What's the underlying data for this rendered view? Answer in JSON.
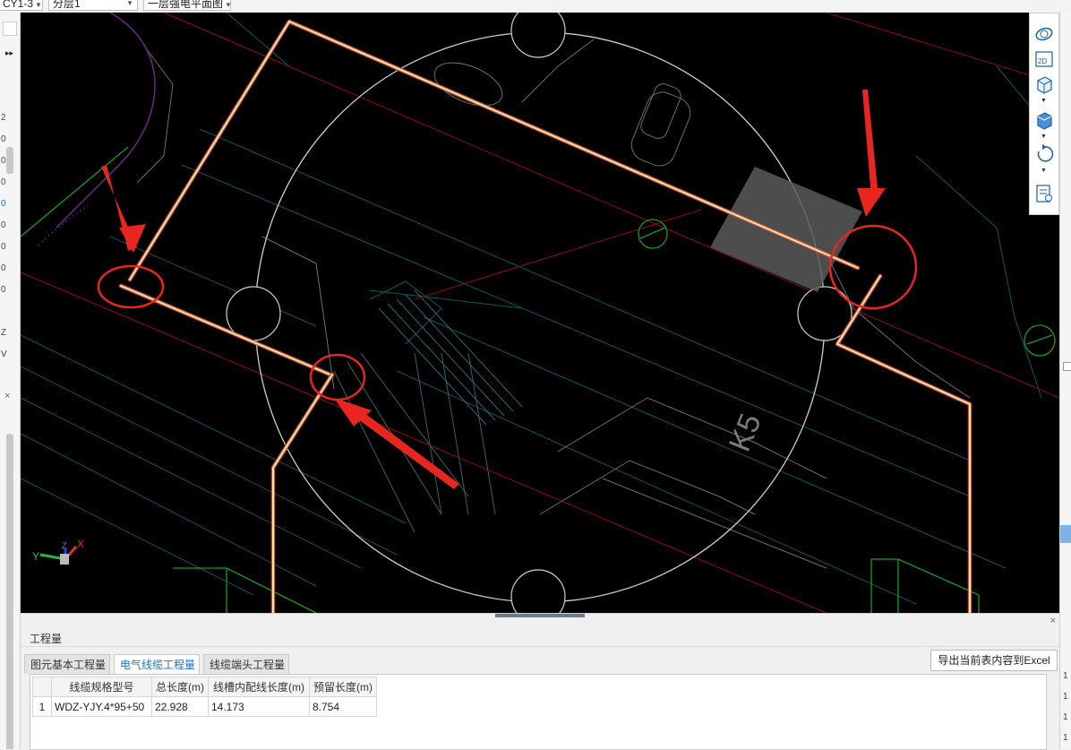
{
  "toolbar": {
    "combo1": "CY1-3",
    "combo2": "分层1",
    "combo3": "一层强电平面图"
  },
  "left_strip": {
    "digits": [
      "2",
      "0",
      "0",
      "0",
      "0",
      "0",
      "0",
      "0",
      "0",
      "Z",
      "V"
    ]
  },
  "right_strip": {
    "digits": [
      "1",
      "1",
      "1",
      "1"
    ]
  },
  "viewport": {
    "axis_labels": {
      "x": "X",
      "y": "Y",
      "z": "Z"
    },
    "cad_text": "K5",
    "annotation_color": "#e8261f",
    "cable_color": "#f4e7a0"
  },
  "view_toolbar": {
    "items": [
      "orbit-icon",
      "2d-view-icon",
      "cube-view-icon",
      "cube-view-alt-icon",
      "rotate-icon",
      "layer-list-icon"
    ]
  },
  "bottom_panel": {
    "title": "工程量",
    "close": "×",
    "tabs": [
      {
        "label": "图元基本工程量",
        "active": false
      },
      {
        "label": "电气线缆工程量",
        "active": true
      },
      {
        "label": "线缆端头工程量",
        "active": false
      }
    ],
    "export_label": "导出当前表内容到Excel",
    "table": {
      "headers": [
        "",
        "线缆规格型号",
        "总长度(m)",
        "线槽内配线长度(m)",
        "预留长度(m)"
      ],
      "rows": [
        [
          "1",
          "WDZ-YJY.4*95+50",
          "22.928",
          "14.173",
          "8.754"
        ]
      ]
    }
  }
}
